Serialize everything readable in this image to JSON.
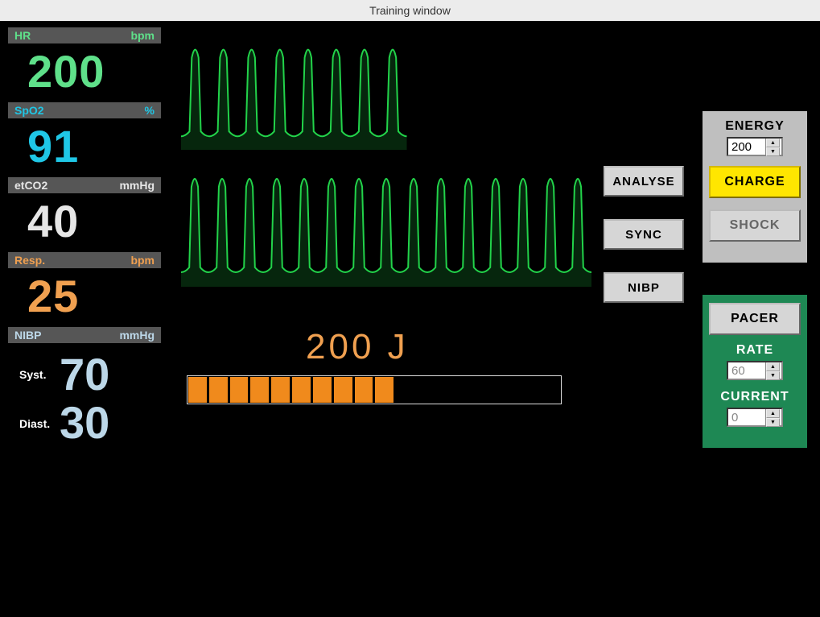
{
  "window": {
    "title": "Training window"
  },
  "vitals": {
    "hr": {
      "label": "HR",
      "unit": "bpm",
      "value": "200"
    },
    "spo2": {
      "label": "SpO2",
      "unit": "%",
      "value": "91"
    },
    "etco2": {
      "label": "etCO2",
      "unit": "mmHg",
      "value": "40"
    },
    "resp": {
      "label": "Resp.",
      "unit": "bpm",
      "value": "25"
    },
    "nibp": {
      "label": "NIBP",
      "unit": "mmHg",
      "syst_label": "Syst.",
      "diast_label": "Diast.",
      "syst": "70",
      "diast": "30"
    }
  },
  "controls": {
    "analyse": "ANALYSE",
    "sync": "SYNC",
    "nibp": "NIBP"
  },
  "defib": {
    "energy_label": "ENERGY",
    "energy_value": "200",
    "charge": "CHARGE",
    "shock": "SHOCK",
    "energy_readout": "200 J",
    "progress_segments": 18,
    "progress_filled": 10
  },
  "pacer": {
    "button": "PACER",
    "rate_label": "RATE",
    "rate_value": "60",
    "current_label": "CURRENT",
    "current_value": "0"
  },
  "chart_data": [
    {
      "type": "line",
      "title": "ECG waveform (top)",
      "cycles_shown": 8,
      "width_fraction": 0.55,
      "amplitude_scale": 1.0
    },
    {
      "type": "line",
      "title": "ECG waveform (bottom)",
      "cycles_shown": 15,
      "width_fraction": 1.0,
      "amplitude_scale": 1.0
    }
  ]
}
